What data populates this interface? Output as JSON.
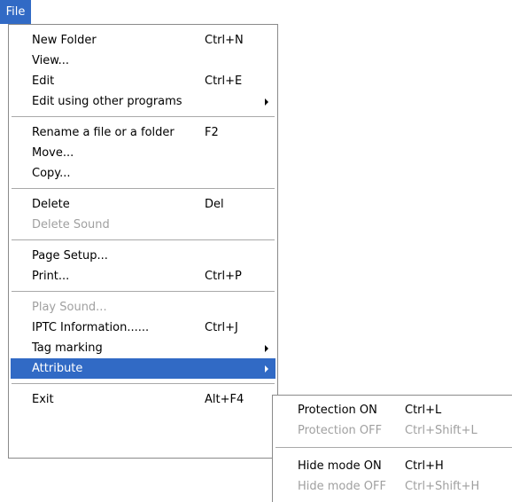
{
  "menubar": {
    "file_label": "File"
  },
  "file_menu": {
    "items": [
      {
        "label": "New Folder",
        "shortcut": "Ctrl+N"
      },
      {
        "label": "View...",
        "shortcut": ""
      },
      {
        "label": "Edit",
        "shortcut": "Ctrl+E"
      },
      {
        "label": "Edit using other programs",
        "shortcut": ""
      },
      {
        "label": "Rename a file or a folder",
        "shortcut": "F2"
      },
      {
        "label": "Move...",
        "shortcut": ""
      },
      {
        "label": "Copy...",
        "shortcut": ""
      },
      {
        "label": "Delete",
        "shortcut": "Del"
      },
      {
        "label": "Delete Sound",
        "shortcut": ""
      },
      {
        "label": "Page Setup...",
        "shortcut": ""
      },
      {
        "label": "Print...",
        "shortcut": "Ctrl+P"
      },
      {
        "label": "Play Sound...",
        "shortcut": ""
      },
      {
        "label": "IPTC Information......",
        "shortcut": "Ctrl+J"
      },
      {
        "label": "Tag marking",
        "shortcut": ""
      },
      {
        "label": "Attribute",
        "shortcut": ""
      },
      {
        "label": "Exit",
        "shortcut": "Alt+F4"
      }
    ]
  },
  "attribute_submenu": {
    "items": [
      {
        "label": "Protection ON",
        "shortcut": "Ctrl+L"
      },
      {
        "label": "Protection OFF",
        "shortcut": "Ctrl+Shift+L"
      },
      {
        "label": "Hide mode ON",
        "shortcut": "Ctrl+H"
      },
      {
        "label": "Hide mode OFF",
        "shortcut": "Ctrl+Shift+H"
      }
    ]
  },
  "colors": {
    "highlight": "#316ac5",
    "disabled_text": "#a0a0a0",
    "separator": "#a9a9a9",
    "border": "#8a8a8a"
  },
  "icons": {
    "submenu_arrow": "triangle-right-icon"
  }
}
